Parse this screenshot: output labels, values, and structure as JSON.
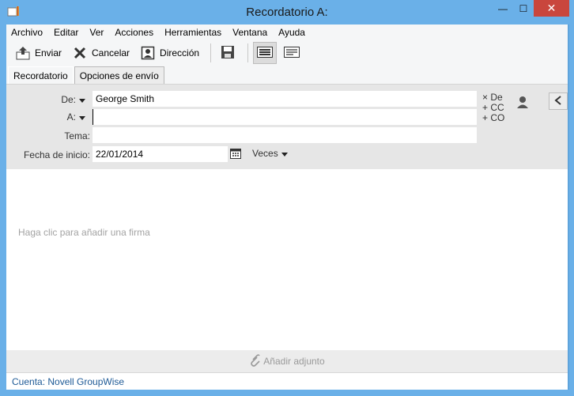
{
  "window": {
    "title": "Recordatorio A:",
    "controls": {
      "minimize": "—",
      "maximize": "☐",
      "close": "✕"
    }
  },
  "menu": [
    "Archivo",
    "Editar",
    "Ver",
    "Acciones",
    "Herramientas",
    "Ventana",
    "Ayuda"
  ],
  "toolbar": {
    "send_label": "Enviar",
    "cancel_label": "Cancelar",
    "address_label": "Dirección"
  },
  "tabs": [
    "Recordatorio",
    "Opciones de envío"
  ],
  "fields": {
    "from_label": "De:",
    "from_value": "George Smith",
    "to_label": "A:",
    "to_value": "",
    "subject_label": "Tema:",
    "subject_value": "",
    "start_date_label": "Fecha de inicio:",
    "start_date_value": "22/01/2014",
    "recurrence_label": "Veces"
  },
  "address_options": [
    "× De",
    "+ CC",
    "+ CO"
  ],
  "body": {
    "signature_hint": "Haga clic para añadir una firma"
  },
  "attach": {
    "label": "Añadir adjunto"
  },
  "status": {
    "account": "Cuenta: Novell GroupWise"
  },
  "colors": {
    "titlebar": "#6ab0e8",
    "close": "#c9463d",
    "status_text": "#1e5a96"
  }
}
